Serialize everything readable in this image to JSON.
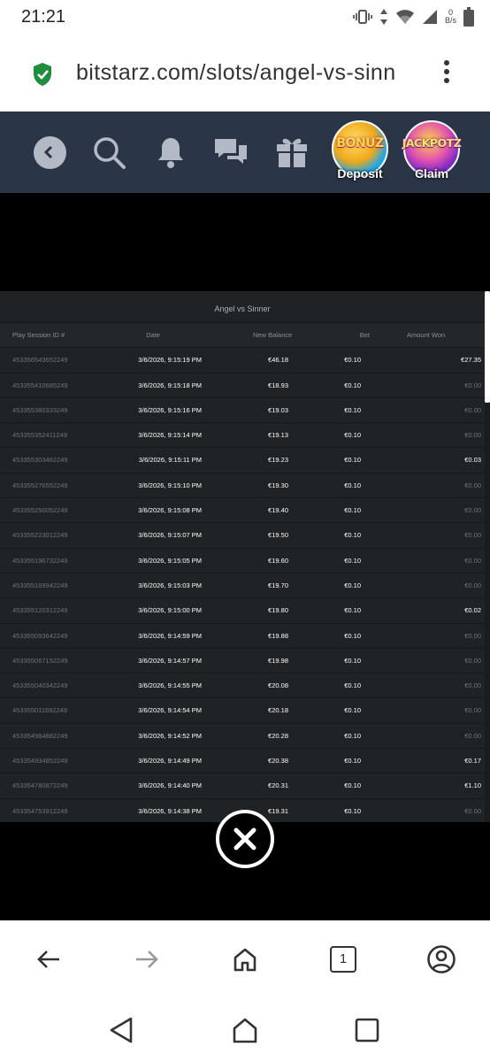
{
  "status_bar": {
    "time": "21:21",
    "net_speed_value": "0",
    "net_speed_unit": "B/s"
  },
  "browser": {
    "url": "bitstarz.com/slots/angel-vs-sinn",
    "tab_count": "1"
  },
  "site_header": {
    "icons": [
      "back-icon",
      "search-icon",
      "bell-icon",
      "chat-icon",
      "gift-icon"
    ],
    "bonuz": {
      "title": "BONUZ",
      "label": "Deposit",
      "color": "#1ea7e8"
    },
    "jackpotz": {
      "title": "JACKPOTZ",
      "label": "Claim",
      "color": "#7b2ac4"
    }
  },
  "history": {
    "title": "Angel vs Sinner",
    "columns": [
      "Play Session ID #",
      "Date",
      "New Balance",
      "Bet",
      "Amount Won"
    ],
    "rows": [
      {
        "id": "453356543652249",
        "date": "3/6/2026, 9:15:19 PM",
        "balance": "€46.18",
        "bet": "€0.10",
        "won": "€27.35",
        "win": true
      },
      {
        "id": "453355410685249",
        "date": "3/6/2026, 9:15:18 PM",
        "balance": "€18.93",
        "bet": "€0.10",
        "won": "€0.00",
        "win": false
      },
      {
        "id": "453355380333249",
        "date": "3/6/2026, 9:15:16 PM",
        "balance": "€19.03",
        "bet": "€0.10",
        "won": "€0.00",
        "win": false
      },
      {
        "id": "453355352411249",
        "date": "3/6/2026, 9:15:14 PM",
        "balance": "€19.13",
        "bet": "€0.10",
        "won": "€0.00",
        "win": false
      },
      {
        "id": "453355303462249",
        "date": "3/6/2026, 9:15:11 PM",
        "balance": "€19.23",
        "bet": "€0.10",
        "won": "€0.03",
        "win": true
      },
      {
        "id": "453355276552249",
        "date": "3/6/2026, 9:15:10 PM",
        "balance": "€19.30",
        "bet": "€0.10",
        "won": "€0.00",
        "win": false
      },
      {
        "id": "453355250052249",
        "date": "3/6/2026, 9:15:08 PM",
        "balance": "€19.40",
        "bet": "€0.10",
        "won": "€0.00",
        "win": false
      },
      {
        "id": "453355223012249",
        "date": "3/6/2026, 9:15:07 PM",
        "balance": "€19.50",
        "bet": "€0.10",
        "won": "€0.00",
        "win": false
      },
      {
        "id": "453355196732249",
        "date": "3/6/2026, 9:15:05 PM",
        "balance": "€19.60",
        "bet": "€0.10",
        "won": "€0.00",
        "win": false
      },
      {
        "id": "453355169942249",
        "date": "3/6/2026, 9:15:03 PM",
        "balance": "€19.70",
        "bet": "€0.10",
        "won": "€0.00",
        "win": false
      },
      {
        "id": "453355120312249",
        "date": "3/6/2026, 9:15:00 PM",
        "balance": "€19.80",
        "bet": "€0.10",
        "won": "€0.02",
        "win": true
      },
      {
        "id": "453355093642249",
        "date": "3/6/2026, 9:14:59 PM",
        "balance": "€19.88",
        "bet": "€0.10",
        "won": "€0.00",
        "win": false
      },
      {
        "id": "453355067152249",
        "date": "3/6/2026, 9:14:57 PM",
        "balance": "€19.98",
        "bet": "€0.10",
        "won": "€0.00",
        "win": false
      },
      {
        "id": "453355040342249",
        "date": "3/6/2026, 9:14:55 PM",
        "balance": "€20.08",
        "bet": "€0.10",
        "won": "€0.00",
        "win": false
      },
      {
        "id": "453355011692249",
        "date": "3/6/2026, 9:14:54 PM",
        "balance": "€20.18",
        "bet": "€0.10",
        "won": "€0.00",
        "win": false
      },
      {
        "id": "453354984882249",
        "date": "3/6/2026, 9:14:52 PM",
        "balance": "€20.28",
        "bet": "€0.10",
        "won": "€0.00",
        "win": false
      },
      {
        "id": "453354934852249",
        "date": "3/6/2026, 9:14:49 PM",
        "balance": "€20.38",
        "bet": "€0.10",
        "won": "€0.17",
        "win": true
      },
      {
        "id": "453354780872249",
        "date": "3/6/2026, 9:14:40 PM",
        "balance": "€20.31",
        "bet": "€0.10",
        "won": "€1.10",
        "win": true
      },
      {
        "id": "453354753912249",
        "date": "3/6/2026, 9:14:38 PM",
        "balance": "€19.31",
        "bet": "€0.10",
        "won": "€0.00",
        "win": false
      }
    ]
  },
  "browser_nav": [
    "back-arrow-icon",
    "forward-arrow-icon",
    "home-icon",
    "tabs-button",
    "account-icon"
  ],
  "system_nav": [
    "system-back-icon",
    "system-home-icon",
    "recents-icon"
  ]
}
